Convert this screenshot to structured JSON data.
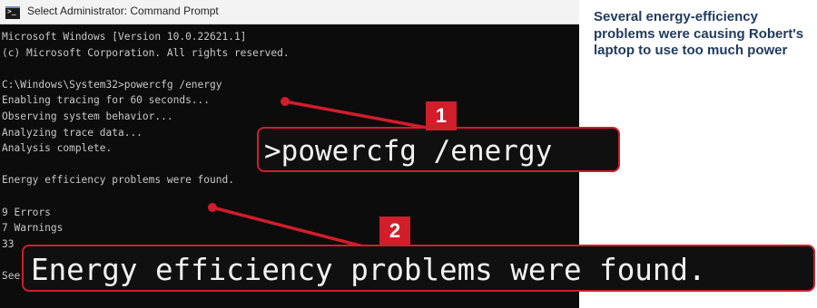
{
  "window": {
    "title": "Select Administrator: Command Prompt",
    "icon": "cmd-icon"
  },
  "console": {
    "lines": [
      "Microsoft Windows [Version 10.0.22621.1]",
      "(c) Microsoft Corporation. All rights reserved.",
      "",
      "C:\\Windows\\System32>powercfg /energy",
      "Enabling tracing for 60 seconds...",
      "Observing system behavior...",
      "Analyzing trace data...",
      "Analysis complete.",
      "",
      "Energy efficiency problems were found.",
      "",
      "9 Errors",
      "7 Warnings",
      "33",
      "",
      "See C:\\Windows\\System32\\energy-report.html for more details."
    ]
  },
  "callouts": [
    {
      "number": "1",
      "text": ">powercfg /energy"
    },
    {
      "number": "2",
      "text": "Energy efficiency problems were found."
    }
  ],
  "caption": "Several energy-efficiency problems were causing Robert's laptop to use too much power",
  "colors": {
    "accent": "#d21d2a",
    "console_bg": "#0c0c0c",
    "console_text": "#c8c8c8",
    "caption_text": "#1f3a5f"
  }
}
